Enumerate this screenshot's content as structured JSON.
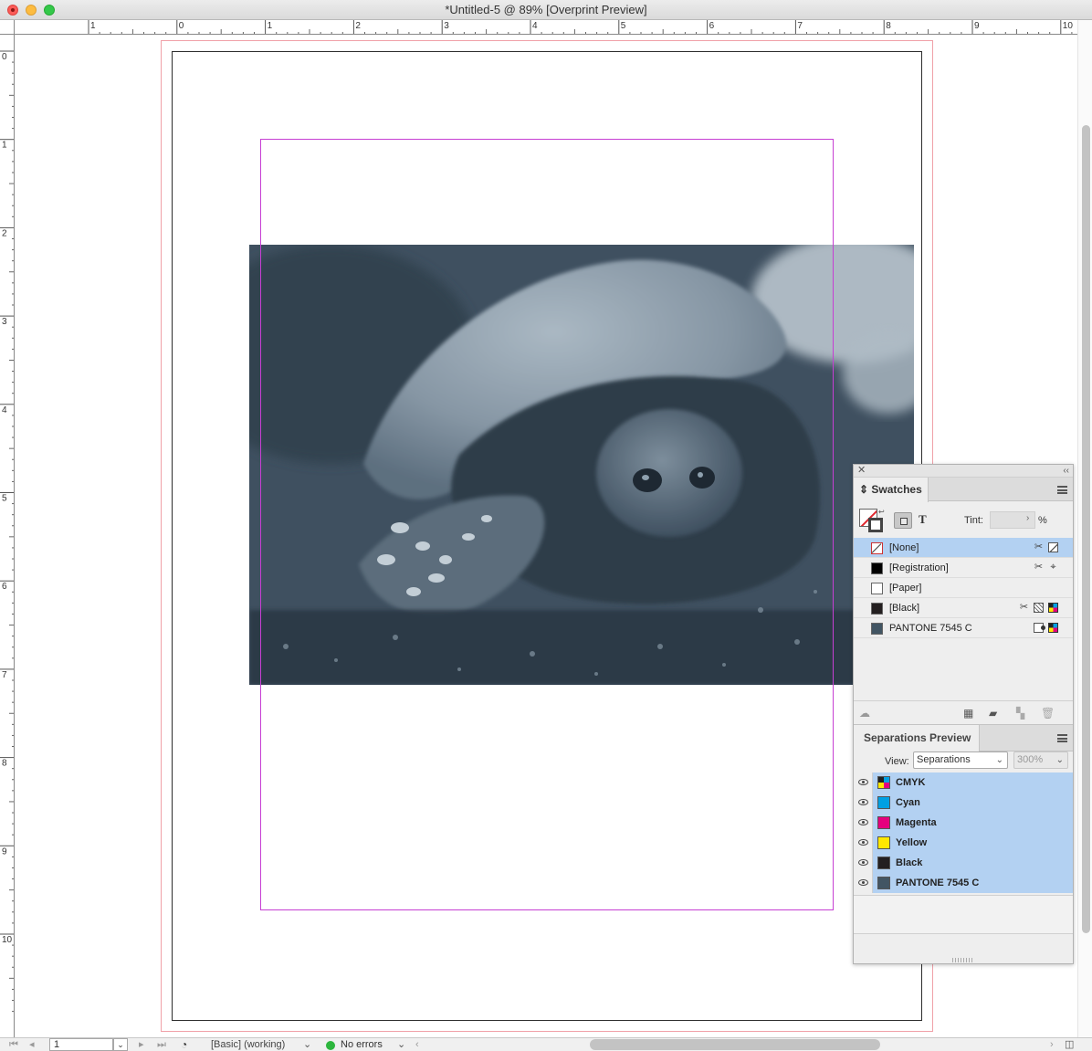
{
  "window": {
    "title": "*Untitled-5 @ 89% [Overprint Preview]"
  },
  "rulers": {
    "horizontal_labels": [
      "1",
      "0",
      "1",
      "2",
      "3",
      "4",
      "5",
      "6",
      "7",
      "8",
      "9",
      "10"
    ],
    "vertical_labels": [
      "0",
      "1",
      "2",
      "3",
      "4",
      "5",
      "6",
      "7",
      "8",
      "9",
      "10"
    ]
  },
  "status_bar": {
    "page_number": "1",
    "preflight_profile": "[Basic] (working)",
    "errors": "No errors"
  },
  "swatches_panel": {
    "tab_label": "Swatches",
    "tint_label": "Tint:",
    "tint_value": "",
    "tint_unit": "%",
    "text_button": "T",
    "swatches": [
      {
        "name": "[None]",
        "selected": true,
        "color": "none",
        "icons": [
          "scissors-lock-icon",
          "none-color-icon"
        ]
      },
      {
        "name": "[Registration]",
        "selected": false,
        "color": "#000000",
        "icons": [
          "scissors-lock-icon",
          "registration-icon"
        ]
      },
      {
        "name": "[Paper]",
        "selected": false,
        "color": "#ffffff",
        "icons": []
      },
      {
        "name": "[Black]",
        "selected": false,
        "color": "#231f20",
        "icons": [
          "scissors-lock-icon",
          "overprint-icon",
          "cmyk-mode-icon"
        ]
      },
      {
        "name": "PANTONE 7545 C",
        "selected": false,
        "color": "#425563",
        "icons": [
          "spot-color-icon",
          "cmyk-mode-icon"
        ]
      }
    ]
  },
  "separations_panel": {
    "tab_label": "Separations Preview",
    "view_label": "View:",
    "view_value": "Separations",
    "zoom_value": "300%",
    "plates": [
      {
        "name": "CMYK",
        "color": "cmyk"
      },
      {
        "name": "Cyan",
        "color": "#00a0e3"
      },
      {
        "name": "Magenta",
        "color": "#e5007e"
      },
      {
        "name": "Yellow",
        "color": "#ffe800"
      },
      {
        "name": "Black",
        "color": "#231f20"
      },
      {
        "name": "PANTONE 7545 C",
        "color": "#425563"
      }
    ]
  },
  "colors": {
    "bleed_guide": "#f0a0a8",
    "margin_guide": "#c63fd3",
    "selection_blue": "#b3d1f2",
    "image_tone": "#425563"
  }
}
